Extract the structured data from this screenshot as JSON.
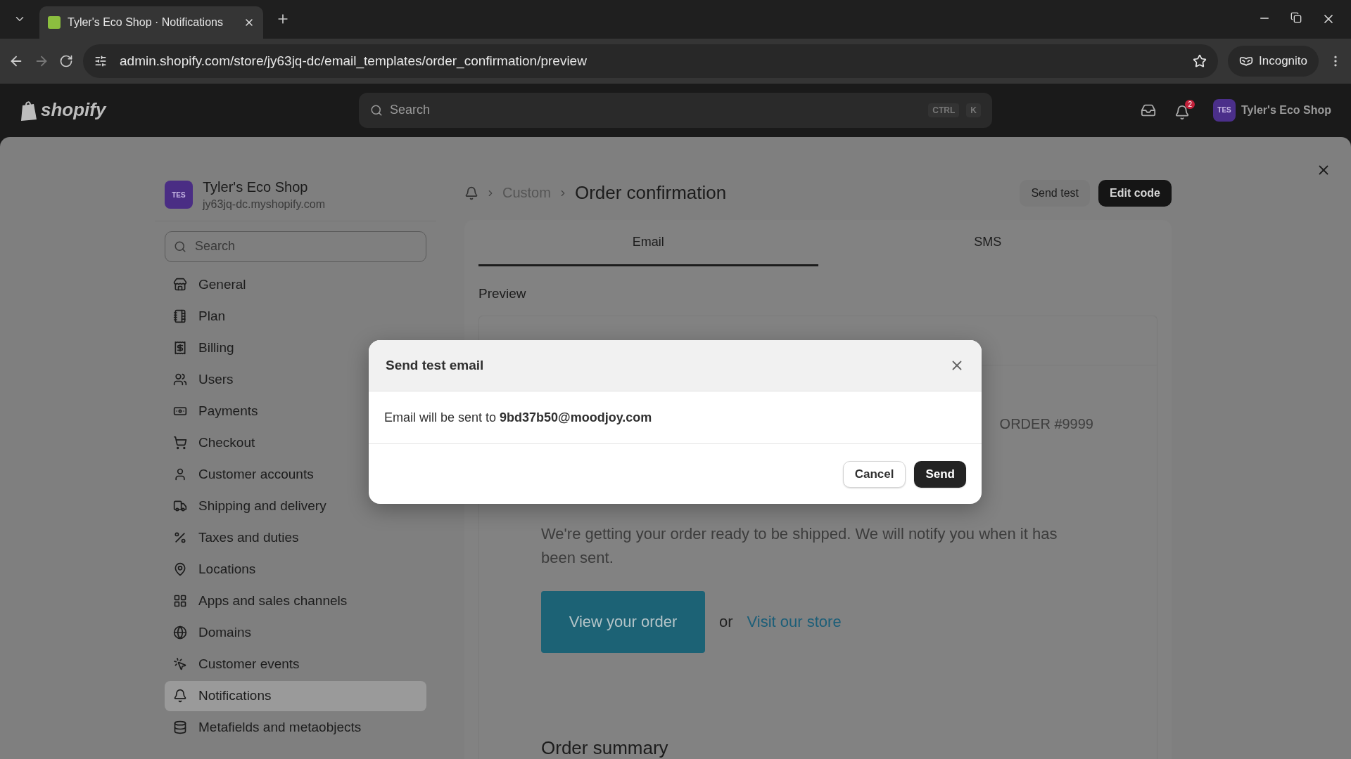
{
  "browser": {
    "tab_title": "Tyler's Eco Shop · Notifications",
    "url": "admin.shopify.com/store/jy63jq-dc/email_templates/order_confirmation/preview",
    "profile_label": "Incognito"
  },
  "topbar": {
    "logo_text": "shopify",
    "search_placeholder": "Search",
    "shortcut": [
      "CTRL",
      "K"
    ],
    "notification_count": "2",
    "store_avatar": "TES",
    "store_name": "Tyler's Eco Shop"
  },
  "sidebar": {
    "store_avatar": "TES",
    "store_name": "Tyler's Eco Shop",
    "store_domain": "jy63jq-dc.myshopify.com",
    "search_placeholder": "Search",
    "items": [
      {
        "label": "General",
        "selected": false
      },
      {
        "label": "Plan",
        "selected": false
      },
      {
        "label": "Billing",
        "selected": false
      },
      {
        "label": "Users",
        "selected": false
      },
      {
        "label": "Payments",
        "selected": false
      },
      {
        "label": "Checkout",
        "selected": false
      },
      {
        "label": "Customer accounts",
        "selected": false
      },
      {
        "label": "Shipping and delivery",
        "selected": false
      },
      {
        "label": "Taxes and duties",
        "selected": false
      },
      {
        "label": "Locations",
        "selected": false
      },
      {
        "label": "Apps and sales channels",
        "selected": false
      },
      {
        "label": "Domains",
        "selected": false
      },
      {
        "label": "Customer events",
        "selected": false
      },
      {
        "label": "Notifications",
        "selected": true
      },
      {
        "label": "Metafields and metaobjects",
        "selected": false
      }
    ]
  },
  "page": {
    "breadcrumb": "Custom",
    "title": "Order confirmation",
    "send_test": "Send test",
    "edit_code": "Edit code",
    "tabs": [
      {
        "label": "Email",
        "selected": true
      },
      {
        "label": "SMS",
        "selected": false
      }
    ],
    "preview_label": "Preview",
    "email": {
      "order_number": "ORDER #9999",
      "message": "We're getting your order ready to be shipped. We will notify you when it has been sent.",
      "button": "View your order",
      "or": "or",
      "link": "Visit our store",
      "summary_heading": "Order summary"
    }
  },
  "dialog": {
    "title": "Send test email",
    "message": "Email will be sent to **9bd37b50@moodjoy.com**",
    "cancel": "Cancel",
    "send": "Send"
  }
}
